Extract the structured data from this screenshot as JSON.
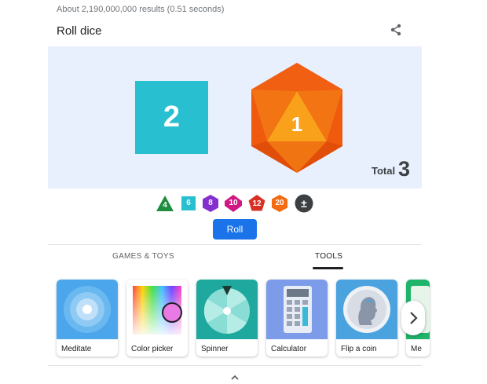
{
  "search": {
    "result_stats": "About 2,190,000,000 results (0.51 seconds)"
  },
  "widget": {
    "title": "Roll dice",
    "dice": [
      {
        "type": "d6",
        "value": "2",
        "color": "#28bfd0"
      },
      {
        "type": "d20",
        "value": "1",
        "color": "#f36c12"
      }
    ],
    "total_label": "Total",
    "total_value": "3",
    "die_options": [
      {
        "label": "4",
        "color": "#1e8e3e"
      },
      {
        "label": "6",
        "color": "#28bfd0"
      },
      {
        "label": "8",
        "color": "#8430ce"
      },
      {
        "label": "10",
        "color": "#d01884"
      },
      {
        "label": "12",
        "color": "#d93025"
      },
      {
        "label": "20",
        "color": "#f36c12"
      },
      {
        "label": "±",
        "color": "#3c4043"
      }
    ],
    "roll_label": "Roll"
  },
  "tabs": [
    {
      "label": "GAMES & TOYS",
      "active": false
    },
    {
      "label": "TOOLS",
      "active": true
    }
  ],
  "tools": [
    {
      "label": "Meditate",
      "icon": "meditate-icon"
    },
    {
      "label": "Color picker",
      "icon": "color-picker-icon"
    },
    {
      "label": "Spinner",
      "icon": "spinner-icon"
    },
    {
      "label": "Calculator",
      "icon": "calculator-icon"
    },
    {
      "label": "Flip a coin",
      "icon": "coin-icon"
    },
    {
      "label": "Me",
      "icon": "metronome-icon"
    }
  ],
  "colors": {
    "accent": "#1a73e8",
    "dice_bg": "#e8f0fe"
  }
}
